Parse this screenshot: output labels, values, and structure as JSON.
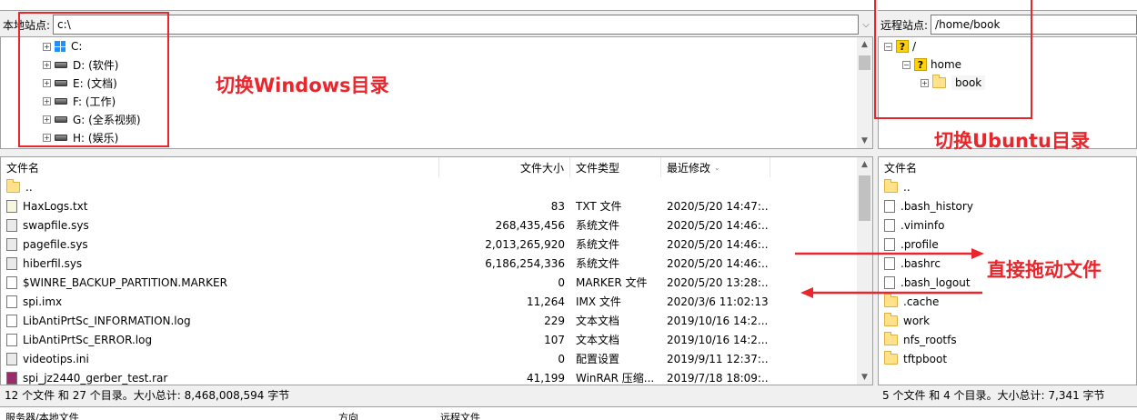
{
  "local": {
    "site_label": "本地站点:",
    "path": "c:\\",
    "tree": [
      {
        "label": "C:",
        "icon": "windows-drive-icon"
      },
      {
        "label": "D: (软件)",
        "icon": "drive-icon"
      },
      {
        "label": "E: (文档)",
        "icon": "drive-icon"
      },
      {
        "label": "F: (工作)",
        "icon": "drive-icon"
      },
      {
        "label": "G: (全系视频)",
        "icon": "drive-icon"
      },
      {
        "label": "H: (娱乐)",
        "icon": "drive-icon"
      }
    ],
    "columns": {
      "name": "文件名",
      "size": "文件大小",
      "type": "文件类型",
      "modified": "最近修改"
    },
    "files": [
      {
        "name": "..",
        "size": "",
        "type": "",
        "modified": "",
        "icon": "folder-icon"
      },
      {
        "name": "HaxLogs.txt",
        "size": "83",
        "type": "TXT 文件",
        "modified": "2020/5/20 14:47:...",
        "icon": "text-file-icon"
      },
      {
        "name": "swapfile.sys",
        "size": "268,435,456",
        "type": "系统文件",
        "modified": "2020/5/20 14:46:...",
        "icon": "system-file-icon"
      },
      {
        "name": "pagefile.sys",
        "size": "2,013,265,920",
        "type": "系统文件",
        "modified": "2020/5/20 14:46:...",
        "icon": "system-file-icon"
      },
      {
        "name": "hiberfil.sys",
        "size": "6,186,254,336",
        "type": "系统文件",
        "modified": "2020/5/20 14:46:...",
        "icon": "system-file-icon"
      },
      {
        "name": "$WINRE_BACKUP_PARTITION.MARKER",
        "size": "0",
        "type": "MARKER 文件",
        "modified": "2020/5/20 13:28:...",
        "icon": "file-icon"
      },
      {
        "name": "spi.imx",
        "size": "11,264",
        "type": "IMX 文件",
        "modified": "2020/3/6 11:02:13",
        "icon": "file-icon"
      },
      {
        "name": "LibAntiPrtSc_INFORMATION.log",
        "size": "229",
        "type": "文本文档",
        "modified": "2019/10/16 14:2...",
        "icon": "file-icon"
      },
      {
        "name": "LibAntiPrtSc_ERROR.log",
        "size": "107",
        "type": "文本文档",
        "modified": "2019/10/16 14:2...",
        "icon": "file-icon"
      },
      {
        "name": "videotips.ini",
        "size": "0",
        "type": "配置设置",
        "modified": "2019/9/11 12:37:...",
        "icon": "settings-file-icon"
      },
      {
        "name": "spi_jz2440_gerber_test.rar",
        "size": "41,199",
        "type": "WinRAR 压缩...",
        "modified": "2019/7/18 18:09:...",
        "icon": "rar-file-icon"
      }
    ],
    "status": "12 个文件 和 27 个目录。大小总计: 8,468,008,594 字节"
  },
  "remote": {
    "site_label": "远程站点:",
    "path": "/home/book",
    "tree": [
      {
        "label": "/",
        "icon": "unknown-folder-icon"
      },
      {
        "label": "home",
        "icon": "unknown-folder-icon"
      },
      {
        "label": "book",
        "icon": "folder-icon"
      }
    ],
    "columns": {
      "name": "文件名"
    },
    "files": [
      {
        "name": "..",
        "icon": "folder-icon"
      },
      {
        "name": ".bash_history",
        "icon": "file-icon"
      },
      {
        "name": ".viminfo",
        "icon": "file-icon"
      },
      {
        "name": ".profile",
        "icon": "file-icon"
      },
      {
        "name": ".bashrc",
        "icon": "file-icon"
      },
      {
        "name": ".bash_logout",
        "icon": "file-icon"
      },
      {
        "name": ".cache",
        "icon": "folder-icon"
      },
      {
        "name": "work",
        "icon": "folder-icon"
      },
      {
        "name": "nfs_rootfs",
        "icon": "folder-icon"
      },
      {
        "name": "tftpboot",
        "icon": "folder-icon"
      }
    ],
    "status": "5 个文件 和 4 个目录。大小总计: 7,341 字节"
  },
  "annotations": {
    "windows": "切换Windows目录",
    "ubuntu": "切换Ubuntu目录",
    "drag": "直接拖动文件"
  },
  "queue": {
    "col1": "服务器/本地文件",
    "col2": "方向",
    "col3": "远程文件"
  },
  "colors": {
    "annotation": "#e8262c",
    "folder": "#ffe28a"
  }
}
